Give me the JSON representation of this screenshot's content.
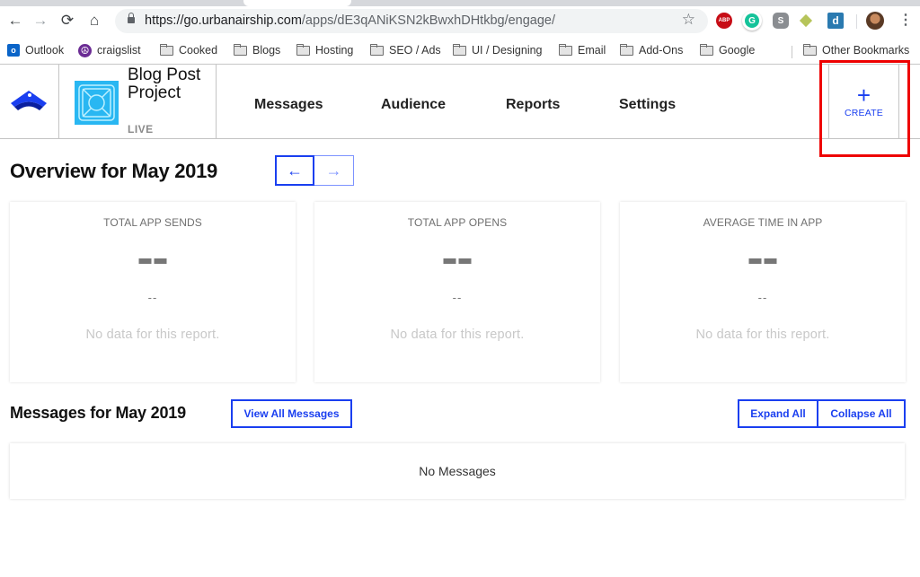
{
  "browser": {
    "url_host": "https://go.urbanairship.com",
    "url_path": "/apps/dE3qANiKSN2kBwxhDHtkbg/engage/",
    "extensions": [
      {
        "name": "adblock-plus",
        "label": "ABP"
      },
      {
        "name": "grammarly",
        "label": "G"
      },
      {
        "name": "skype",
        "label": "S"
      },
      {
        "name": "gem-extension",
        "label": ""
      },
      {
        "name": "d-extension",
        "label": "d"
      }
    ],
    "bookmarks": [
      {
        "label": "Outlook",
        "icon": "outlook-icon"
      },
      {
        "label": "craigslist",
        "icon": "peace-icon"
      },
      {
        "label": "Cooked",
        "icon": "folder-icon"
      },
      {
        "label": "Blogs",
        "icon": "folder-icon"
      },
      {
        "label": "Hosting",
        "icon": "folder-icon"
      },
      {
        "label": "SEO / Ads",
        "icon": "folder-icon"
      },
      {
        "label": "UI / Designing",
        "icon": "folder-icon"
      },
      {
        "label": "Email",
        "icon": "folder-icon"
      },
      {
        "label": "Add-Ons",
        "icon": "folder-icon"
      },
      {
        "label": "Google",
        "icon": "folder-icon"
      }
    ],
    "other_bookmarks": "Other Bookmarks"
  },
  "app": {
    "project_name": "Blog Post Project",
    "project_status": "LIVE",
    "nav": [
      "Messages",
      "Audience",
      "Reports",
      "Settings"
    ],
    "create_label": "CREATE",
    "accent_color": "#1a3ff0",
    "highlight_color": "#ee0000"
  },
  "overview": {
    "title": "Overview for May 2019",
    "prev_arrow": "←",
    "next_arrow": "→",
    "cards": [
      {
        "title": "TOTAL APP SENDS",
        "value": "--",
        "sub_value": "--",
        "empty_text": "No data for this report."
      },
      {
        "title": "TOTAL APP OPENS",
        "value": "--",
        "sub_value": "--",
        "empty_text": "No data for this report."
      },
      {
        "title": "AVERAGE TIME IN APP",
        "value": "--",
        "sub_value": "--",
        "empty_text": "No data for this report."
      }
    ]
  },
  "messages": {
    "title": "Messages for May 2019",
    "view_all_label": "View All Messages",
    "expand_all_label": "Expand All",
    "collapse_all_label": "Collapse All",
    "empty_text": "No Messages"
  }
}
